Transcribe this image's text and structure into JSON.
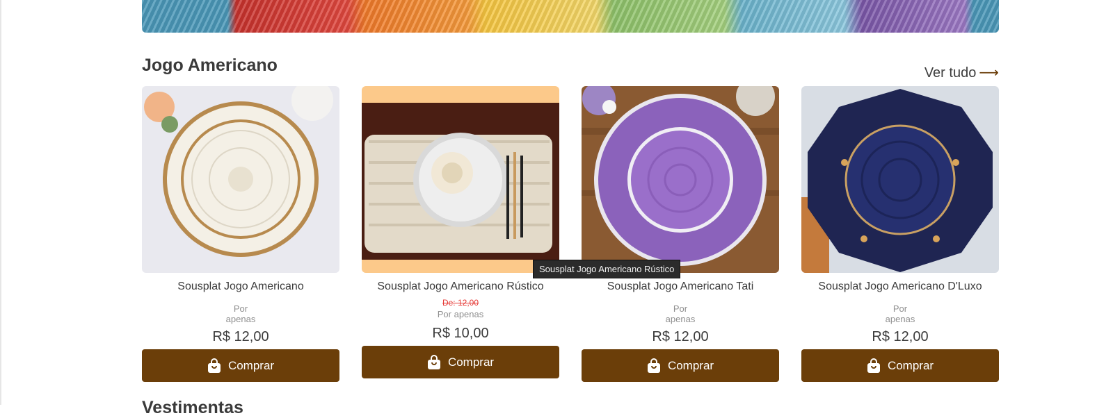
{
  "section": {
    "title": "Jogo Americano",
    "view_all": "Ver tudo",
    "arrow": "⟶"
  },
  "products": [
    {
      "name": "Sousplat Jogo Americano",
      "por": "Por",
      "apenas": "apenas",
      "price": "R$ 12,00",
      "buy": "Comprar"
    },
    {
      "name": "Sousplat Jogo Americano Rústico",
      "old_price": "De: 12,00",
      "por_apenas": "Por apenas",
      "price": "R$ 10,00",
      "buy": "Comprar"
    },
    {
      "name": "Sousplat Jogo Americano Tati",
      "por": "Por",
      "apenas": "apenas",
      "price": "R$ 12,00",
      "buy": "Comprar"
    },
    {
      "name": "Sousplat Jogo Americano D'Luxo",
      "por": "Por",
      "apenas": "apenas",
      "price": "R$ 12,00",
      "buy": "Comprar"
    }
  ],
  "tooltip": "Sousplat Jogo Americano Rústico",
  "next_section": {
    "title": "Vestimentas"
  },
  "colors": {
    "accent": "#6b3e09",
    "old_price": "#e53935",
    "muted_text": "#8f8f8f",
    "tooltip_bg": "#2b2b2b"
  },
  "icons": [
    "shopping-bag-icon",
    "arrow-right-icon"
  ]
}
